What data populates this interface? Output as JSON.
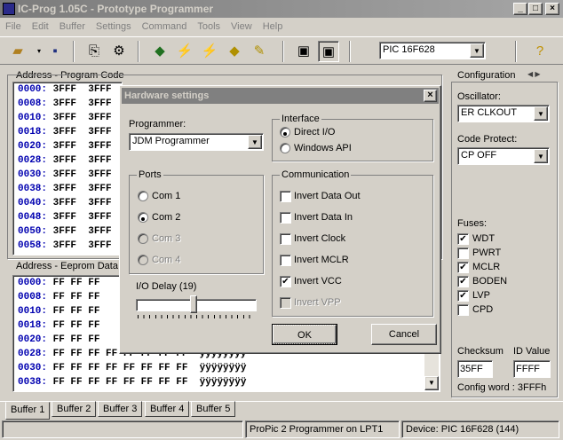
{
  "window": {
    "title": "IC-Prog 1.05C - Prototype Programmer",
    "min": "_",
    "max": "□",
    "close": "×"
  },
  "menu": [
    "File",
    "Edit",
    "Buffer",
    "Settings",
    "Command",
    "Tools",
    "View",
    "Help"
  ],
  "toolbar": {
    "device": "PIC 16F628"
  },
  "program": {
    "label": "Address - Program Code",
    "rows": [
      [
        "0000:",
        "3FFF  3FFF"
      ],
      [
        "0008:",
        "3FFF  3FFF"
      ],
      [
        "0010:",
        "3FFF  3FFF"
      ],
      [
        "0018:",
        "3FFF  3FFF"
      ],
      [
        "0020:",
        "3FFF  3FFF"
      ],
      [
        "0028:",
        "3FFF  3FFF"
      ],
      [
        "0030:",
        "3FFF  3FFF"
      ],
      [
        "0038:",
        "3FFF  3FFF"
      ],
      [
        "0040:",
        "3FFF  3FFF"
      ],
      [
        "0048:",
        "3FFF  3FFF"
      ],
      [
        "0050:",
        "3FFF  3FFF"
      ],
      [
        "0058:",
        "3FFF  3FFF"
      ]
    ]
  },
  "eeprom": {
    "label": "Address - Eeprom Data",
    "rows": [
      [
        "0000:",
        "FF FF FF"
      ],
      [
        "0008:",
        "FF FF FF"
      ],
      [
        "0010:",
        "FF FF FF"
      ],
      [
        "0018:",
        "FF FF FF"
      ],
      [
        "0020:",
        "FF FF FF"
      ],
      [
        "0028:",
        "FF FF FF FF FF FF FF FF  ÿÿÿÿÿÿÿÿ"
      ],
      [
        "0030:",
        "FF FF FF FF FF FF FF FF  ÿÿÿÿÿÿÿÿ"
      ],
      [
        "0038:",
        "FF FF FF FF FF FF FF FF  ÿÿÿÿÿÿÿÿ"
      ]
    ]
  },
  "config": {
    "title": "Configuration",
    "osc_label": "Oscillator:",
    "osc_value": "ER CLKOUT",
    "cp_label": "Code Protect:",
    "cp_value": "CP OFF",
    "fuses_label": "Fuses:",
    "fuses": [
      {
        "name": "WDT",
        "checked": true
      },
      {
        "name": "PWRT",
        "checked": false
      },
      {
        "name": "MCLR",
        "checked": true
      },
      {
        "name": "BODEN",
        "checked": true
      },
      {
        "name": "LVP",
        "checked": true
      },
      {
        "name": "CPD",
        "checked": false
      }
    ],
    "checksum_label": "Checksum",
    "checksum": "35FF",
    "idvalue_label": "ID Value",
    "idvalue": "FFFF",
    "configword": "Config word : 3FFFh"
  },
  "tabs": [
    "Buffer 1",
    "Buffer 2",
    "Buffer 3",
    "Buffer 4",
    "Buffer 5"
  ],
  "status": {
    "programmer": "ProPic 2 Programmer on LPT1",
    "device": "Device: PIC 16F628  (144)"
  },
  "dialog": {
    "title": "Hardware settings",
    "close": "×",
    "programmer_label": "Programmer:",
    "programmer_value": "JDM Programmer",
    "ports_label": "Ports",
    "ports": [
      {
        "name": "Com 1",
        "selected": false,
        "enabled": true
      },
      {
        "name": "Com 2",
        "selected": true,
        "enabled": true
      },
      {
        "name": "Com 3",
        "selected": false,
        "enabled": false
      },
      {
        "name": "Com 4",
        "selected": false,
        "enabled": false
      }
    ],
    "iodelay_label": "I/O Delay (19)",
    "iodelay": 19,
    "interface_label": "Interface",
    "interfaces": [
      {
        "name": "Direct I/O",
        "selected": true
      },
      {
        "name": "Windows API",
        "selected": false
      }
    ],
    "comm_label": "Communication",
    "comm": [
      {
        "name": "Invert Data Out",
        "checked": false,
        "enabled": true
      },
      {
        "name": "Invert Data In",
        "checked": false,
        "enabled": true
      },
      {
        "name": "Invert Clock",
        "checked": false,
        "enabled": true
      },
      {
        "name": "Invert MCLR",
        "checked": false,
        "enabled": true
      },
      {
        "name": "Invert VCC",
        "checked": true,
        "enabled": true
      },
      {
        "name": "Invert VPP",
        "checked": false,
        "enabled": false
      }
    ],
    "ok": "OK",
    "cancel": "Cancel"
  }
}
